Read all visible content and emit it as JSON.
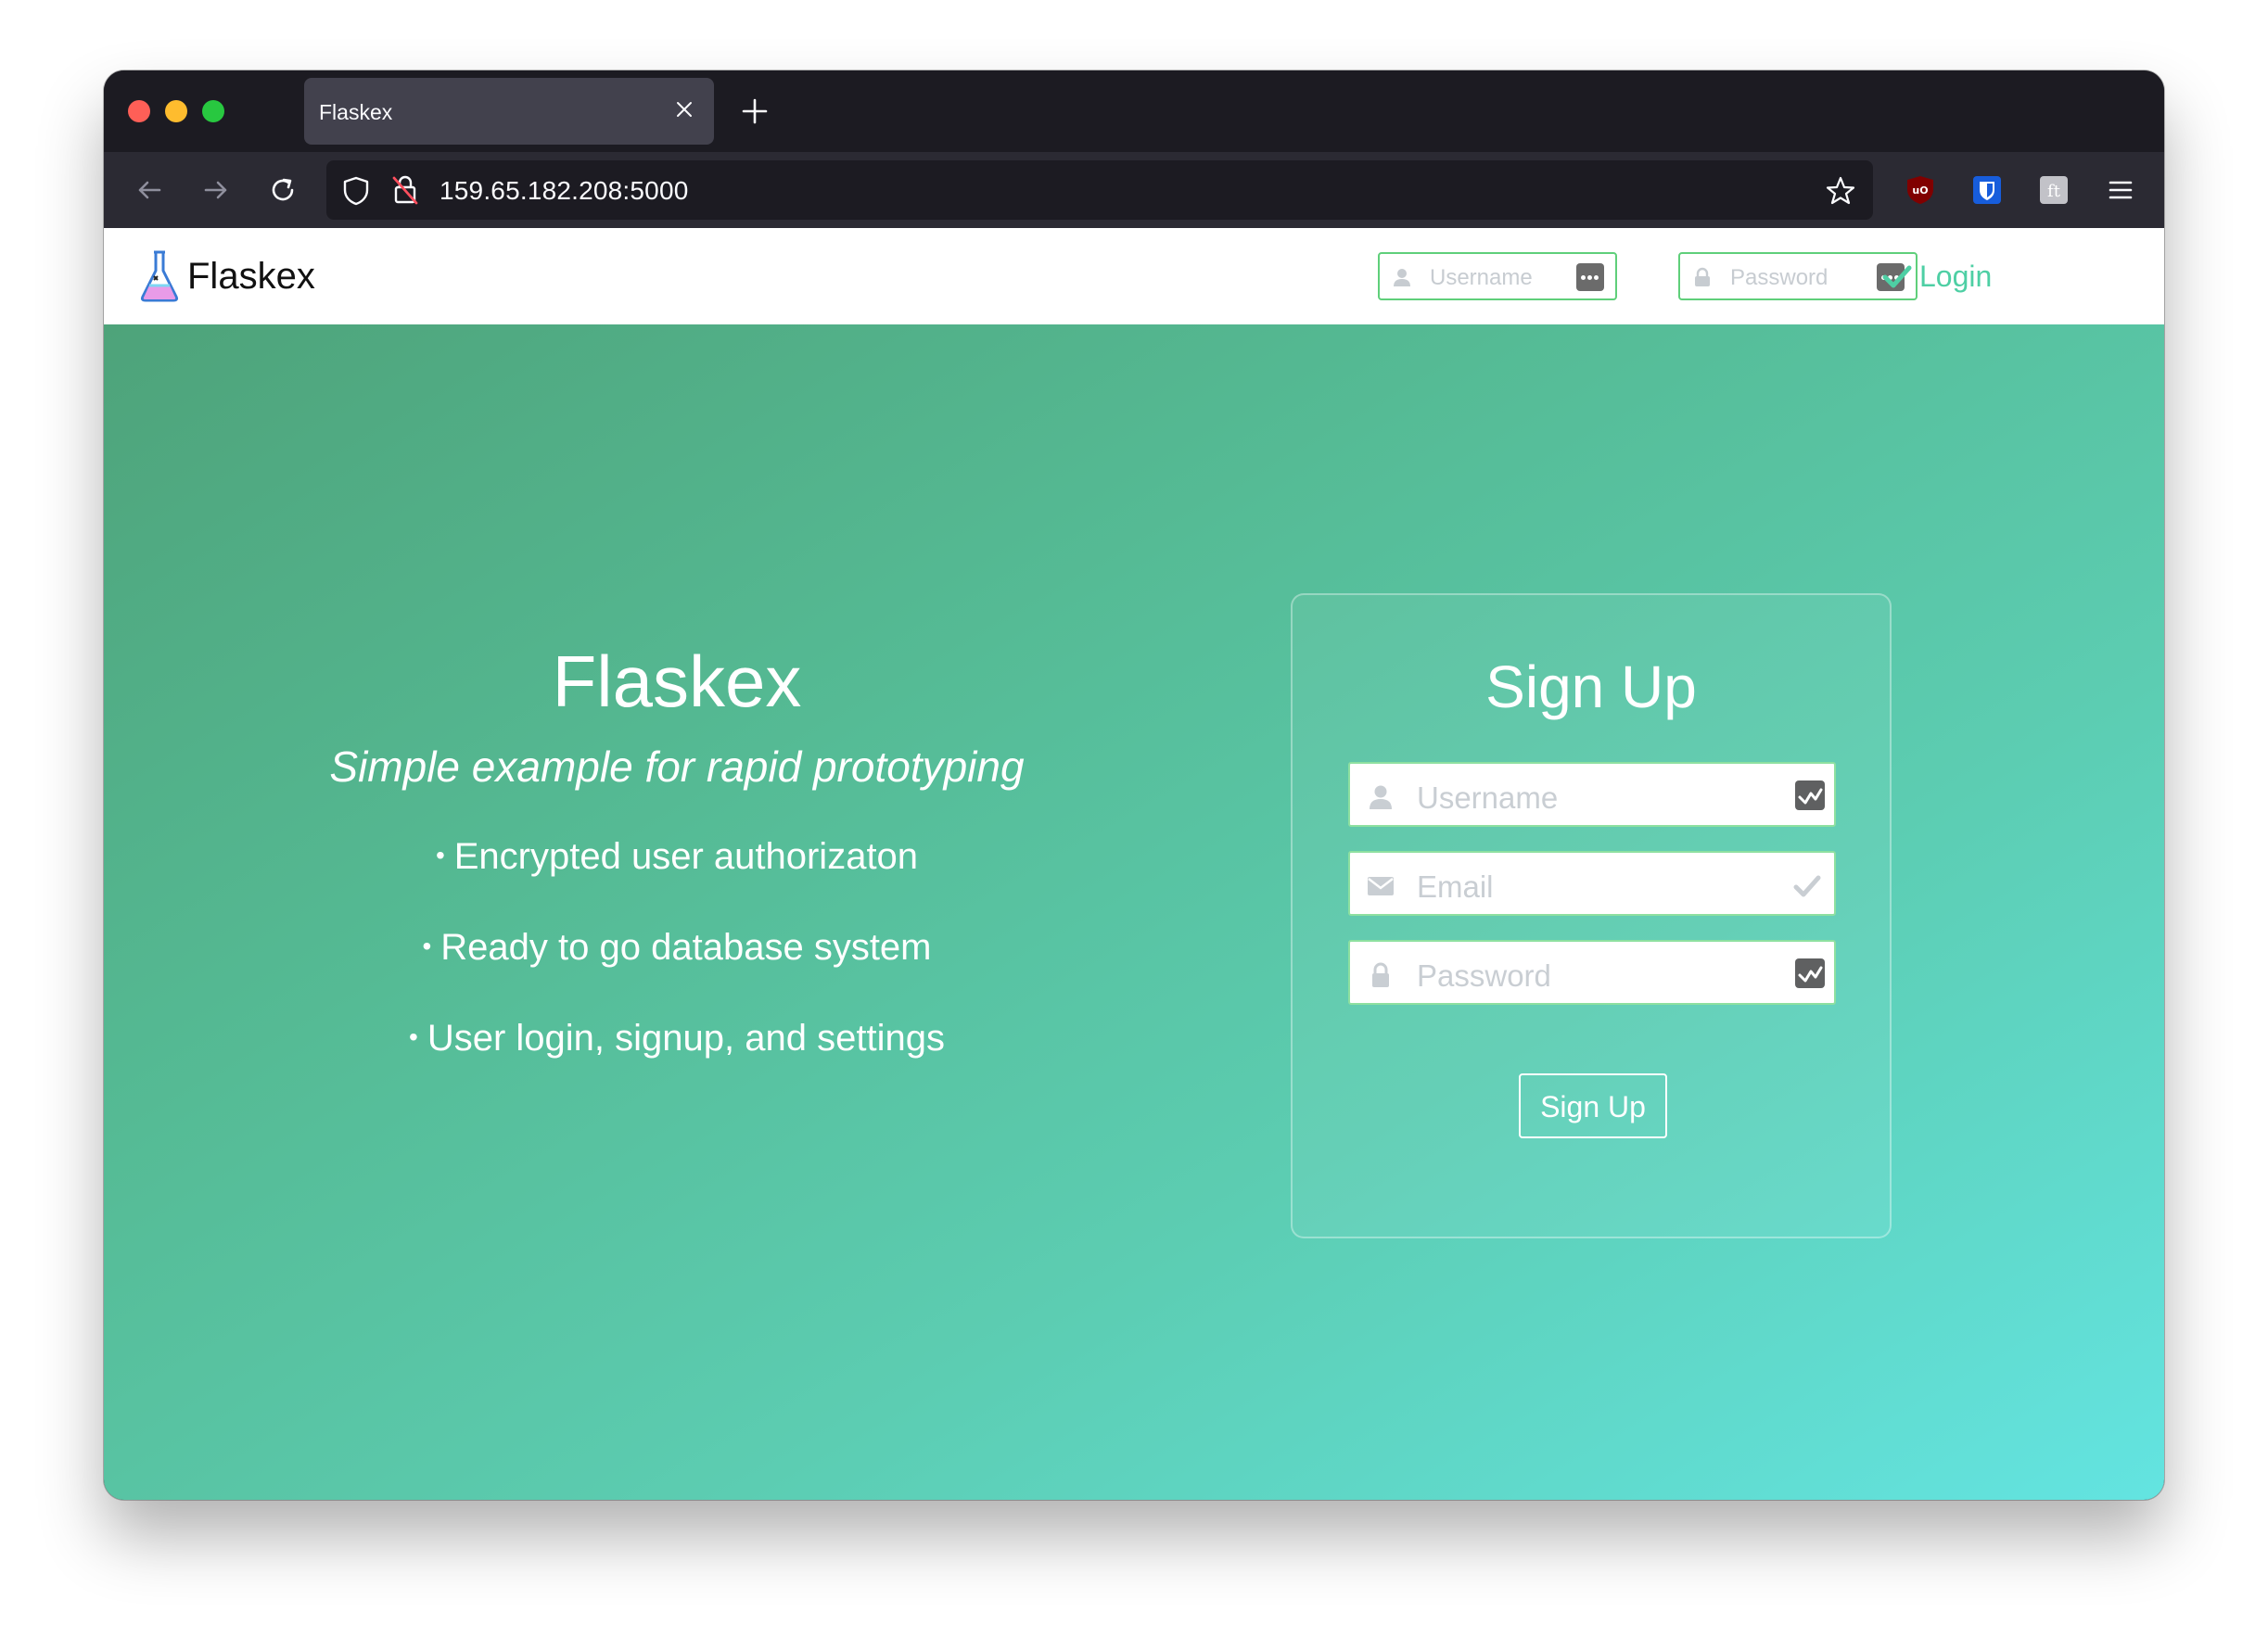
{
  "browser": {
    "tab_title": "Flaskex",
    "url": "159.65.182.208:5000"
  },
  "site": {
    "brand": "Flaskex",
    "nav_username_placeholder": "Username",
    "nav_password_placeholder": "Password",
    "login_label": "Login"
  },
  "hero": {
    "title": "Flaskex",
    "subtitle": "Simple example for rapid prototyping",
    "features": [
      "Encrypted user authorizaton",
      "Ready to go database system",
      "User login, signup, and settings"
    ]
  },
  "signup": {
    "title": "Sign Up",
    "username_placeholder": "Username",
    "email_placeholder": "Email",
    "password_placeholder": "Password",
    "button_label": "Sign Up"
  },
  "colors": {
    "accent": "#4ecfa4",
    "input_border": "#5fcf7a",
    "gradient_start": "#4ea37a",
    "gradient_end": "#63e4e1"
  }
}
